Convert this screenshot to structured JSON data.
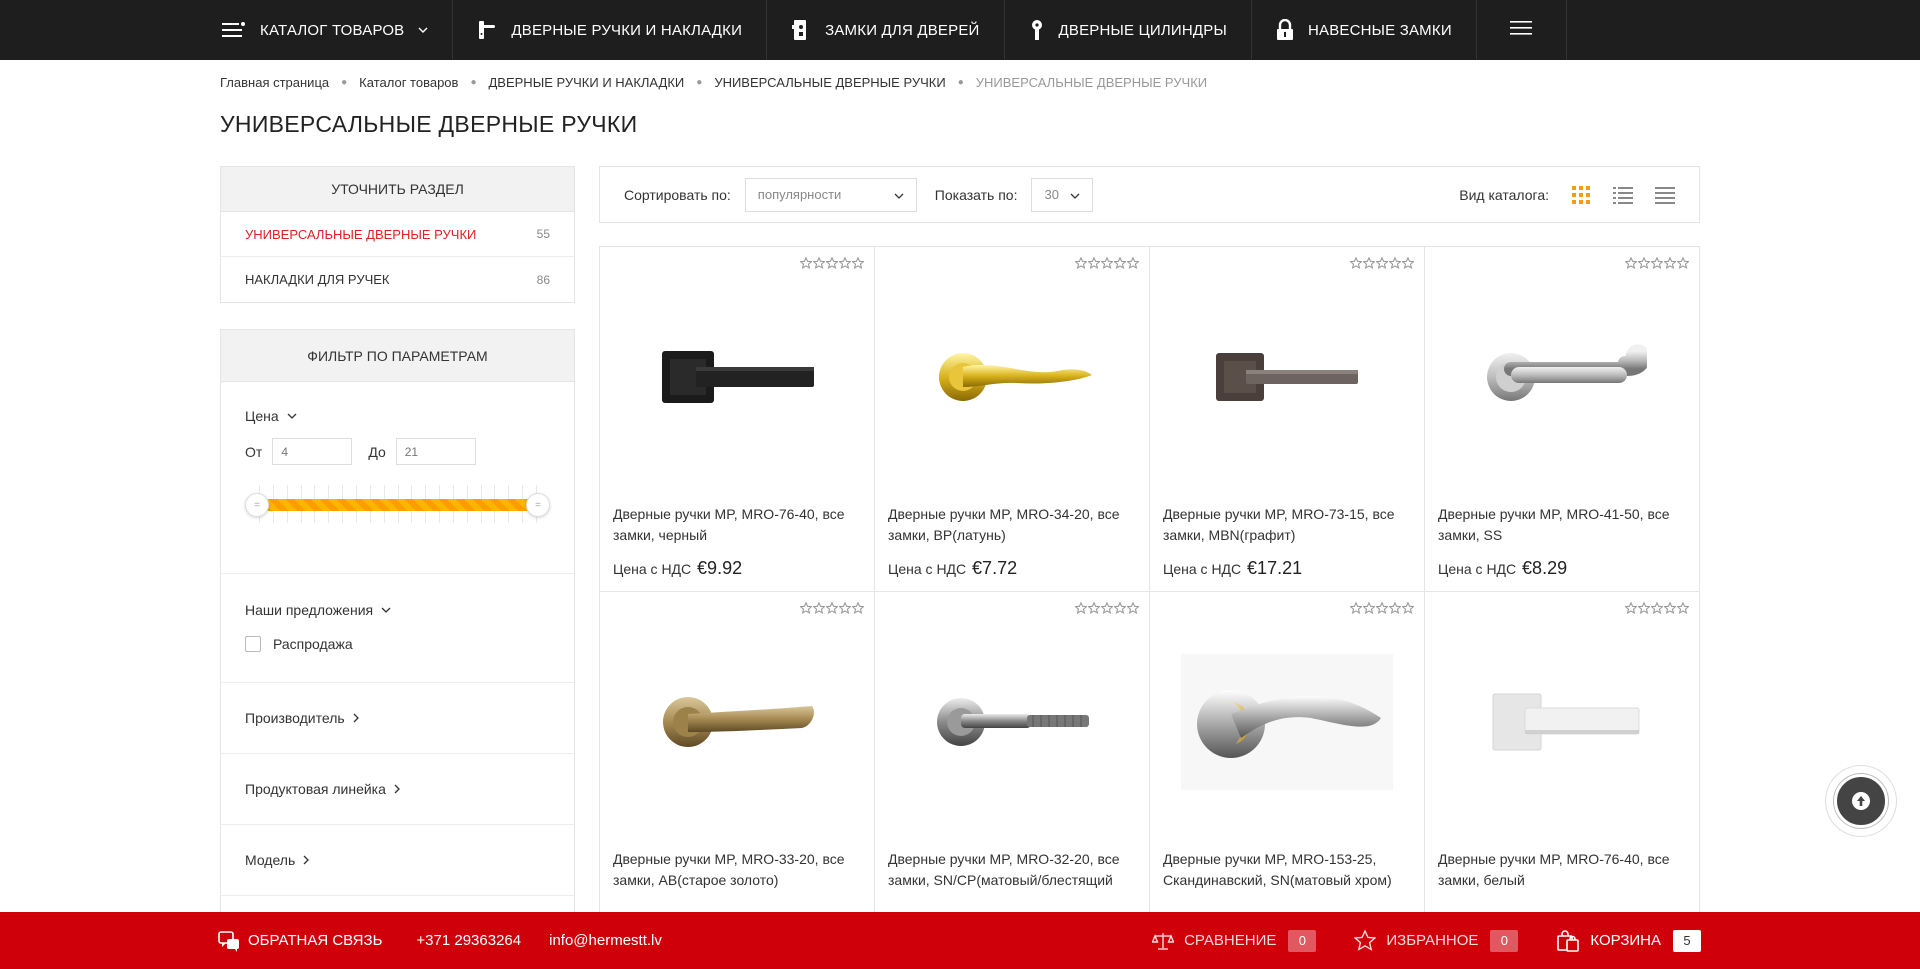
{
  "nav": {
    "items": [
      {
        "label": "КАТАЛОГ ТОВАРОВ",
        "icon": "catalog-menu-icon"
      },
      {
        "label": "ДВЕРНЫЕ РУЧКИ И НАКЛАДКИ",
        "icon": "door-handle-icon"
      },
      {
        "label": "ЗАМКИ ДЛЯ ДВЕРЕЙ",
        "icon": "door-lock-icon"
      },
      {
        "label": "ДВЕРНЫЕ ЦИЛИНДРЫ",
        "icon": "key-cylinder-icon"
      },
      {
        "label": "НАВЕСНЫЕ ЗАМКИ",
        "icon": "padlock-icon"
      }
    ]
  },
  "breadcrumb": [
    "Главная страница",
    "Каталог товаров",
    "ДВЕРНЫЕ РУЧКИ И НАКЛАДКИ",
    "УНИВЕРСАЛЬНЫЕ ДВЕРНЫЕ РУЧКИ",
    "УНИВЕРСАЛЬНЫЕ ДВЕРНЫЕ РУЧКИ"
  ],
  "page_title": "УНИВЕРСАЛЬНЫЕ ДВЕРНЫЕ РУЧКИ",
  "sections": {
    "title": "УТОЧНИТЬ РАЗДЕЛ",
    "items": [
      {
        "label": "УНИВЕРСАЛЬНЫЕ ДВЕРНЫЕ РУЧКИ",
        "count": "55",
        "active": true
      },
      {
        "label": "НАКЛАДКИ ДЛЯ РУЧЕК",
        "count": "86",
        "active": false
      }
    ]
  },
  "filter": {
    "title": "ФИЛЬТР ПО ПАРАМЕТРАМ",
    "price": {
      "label": "Цена",
      "from_label": "От",
      "to_label": "До",
      "from_placeholder": "4",
      "to_placeholder": "21"
    },
    "offers": {
      "label": "Наши предложения",
      "sale_label": "Распродажа"
    },
    "manufacturer": "Производитель",
    "product_line": "Продуктовая линейка",
    "model": "Модель"
  },
  "toolbar": {
    "sort_label": "Сортировать по:",
    "sort_value": "популярности",
    "show_label": "Показать по:",
    "show_value": "30",
    "view_label": "Вид каталога:"
  },
  "products": [
    {
      "name": "Дверные ручки MP, MRO-76-40, все замки, черный",
      "price_label": "Цена с НДС",
      "price": "€9.92",
      "image": "handle-black"
    },
    {
      "name": "Дверные ручки MP, MRO-34-20, все замки, BP(латунь)",
      "price_label": "Цена с НДС",
      "price": "€7.72",
      "image": "handle-brass"
    },
    {
      "name": "Дверные ручки MP, MRO-73-15, все замки, MBN(графит)",
      "price_label": "Цена с НДС",
      "price": "€17.21",
      "image": "handle-graphite"
    },
    {
      "name": "Дверные ручки MP, MRO-41-50, все замки, SS",
      "price_label": "Цена с НДС",
      "price": "€8.29",
      "image": "handle-steel"
    },
    {
      "name": "Дверные ручки MP, MRO-33-20, все замки, AB(старое золото)",
      "image": "handle-antique-brass"
    },
    {
      "name": "Дверные ручки MP, MRO-32-20, все замки, SN/CP(матовый/блестящий",
      "image": "handle-satin-chrome"
    },
    {
      "name": "Дверные ручки MP, MRO-153-25, Скандинавский, SN(матовый хром)",
      "image": "handle-scandinavian"
    },
    {
      "name": "Дверные ручки MP, MRO-76-40, все замки, белый",
      "image": "handle-white"
    }
  ],
  "bottombar": {
    "feedback": "ОБРАТНАЯ СВЯЗЬ",
    "phone": "+371 29363264",
    "email": "info@hermestt.lv",
    "compare_label": "СРАВНЕНИЕ",
    "compare_count": "0",
    "favorites_label": "ИЗБРАННОЕ",
    "favorites_count": "0",
    "cart_label": "КОРЗИНА",
    "cart_count": "5"
  },
  "colors": {
    "accent_red": "#d0000b",
    "active_link": "#e01e25",
    "slider_orange": "#ffb400",
    "view_active": "#f39c12",
    "nav_bg": "#1e1e1e"
  }
}
